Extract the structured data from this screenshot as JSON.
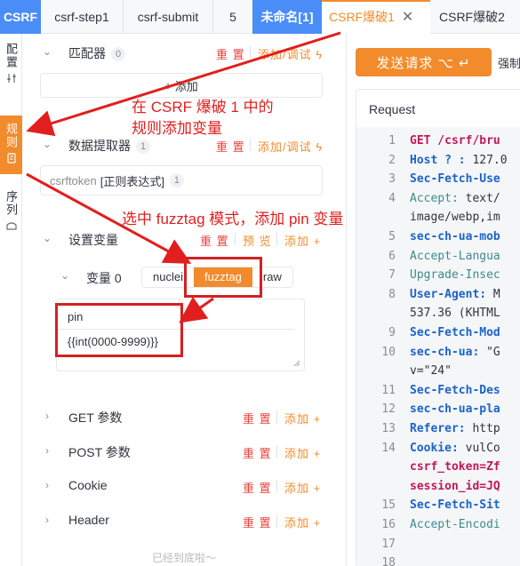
{
  "tabs": {
    "app": "CSRF",
    "group_tabs": [
      "csrf-step1",
      "csrf-submit",
      "5"
    ],
    "active_group": "未命名[1]",
    "sub_tabs": [
      "CSRF爆破1",
      "CSRF爆破2"
    ],
    "close_glyph": "✕"
  },
  "rail": {
    "config": "配置",
    "rules": "规则",
    "sequence": "序列"
  },
  "matcher": {
    "title": "匹配器",
    "count": "0",
    "reset": "重 置",
    "add_debug": "添加/调试",
    "add": "添加"
  },
  "extractor": {
    "title": "数据提取器",
    "count": "1",
    "reset": "重 置",
    "add_debug": "添加/调试",
    "item_name": "csrftoken",
    "item_type": "[正则表达式]",
    "item_count": "1"
  },
  "set_vars": {
    "title": "设置变量",
    "reset": "重 置",
    "preview": "预 览",
    "add": "添加",
    "var_label": "变量 0",
    "modes": [
      "nuclei",
      "fuzztag",
      "raw"
    ],
    "active_mode": "fuzztag",
    "var_name": "pin",
    "var_value": "{{int(0000-9999)}}"
  },
  "sections": [
    {
      "title": "GET 参数",
      "reset": "重 置",
      "add": "添加"
    },
    {
      "title": "POST 参数",
      "reset": "重 置",
      "add": "添加"
    },
    {
      "title": "Cookie",
      "reset": "重 置",
      "add": "添加"
    },
    {
      "title": "Header",
      "reset": "重 置",
      "add": "添加"
    }
  ],
  "footer": "已经到底啦～",
  "right": {
    "send": "发送请求 ⌥ ↵",
    "force": "强制",
    "request_title": "Request",
    "lines": [
      {
        "n": "1",
        "t": "GET /csrf/bru"
      },
      {
        "n": "2",
        "t": "Host ? : 127.0"
      },
      {
        "n": "3",
        "t": "Sec-Fetch-Use"
      },
      {
        "n": "4",
        "t": "Accept: text/"
      },
      {
        "n": "",
        "t": "image/webp,im"
      },
      {
        "n": "5",
        "t": "sec-ch-ua-mob"
      },
      {
        "n": "6",
        "t": "Accept-Langua"
      },
      {
        "n": "7",
        "t": "Upgrade-Insec"
      },
      {
        "n": "8",
        "t": "User-Agent: M"
      },
      {
        "n": "",
        "t": "537.36 (KHTML"
      },
      {
        "n": "9",
        "t": "Sec-Fetch-Mod"
      },
      {
        "n": "10",
        "t": "sec-ch-ua: \"G"
      },
      {
        "n": "",
        "t": "v=\"24\""
      },
      {
        "n": "11",
        "t": "Sec-Fetch-Des"
      },
      {
        "n": "12",
        "t": "sec-ch-ua-pla"
      },
      {
        "n": "13",
        "t": "Referer: http"
      },
      {
        "n": "14",
        "t": "Cookie: vulCo"
      },
      {
        "n": "",
        "t": "csrf_token=Zf"
      },
      {
        "n": "",
        "t": "session_id=JQ"
      },
      {
        "n": "15",
        "t": "Sec-Fetch-Sit"
      },
      {
        "n": "16",
        "t": "Accept-Encodi"
      },
      {
        "n": "17",
        "t": ""
      },
      {
        "n": "18",
        "t": ""
      }
    ]
  },
  "annotations": {
    "a1_line1": "在 CSRF 爆破 1 中的",
    "a1_line2": "规则添加变量",
    "a2": "选中 fuzztag 模式，添加 pin 变量"
  },
  "colors": {
    "accent": "#f28b2c",
    "blue": "#4a8df7",
    "annotation": "#e11f1f"
  }
}
